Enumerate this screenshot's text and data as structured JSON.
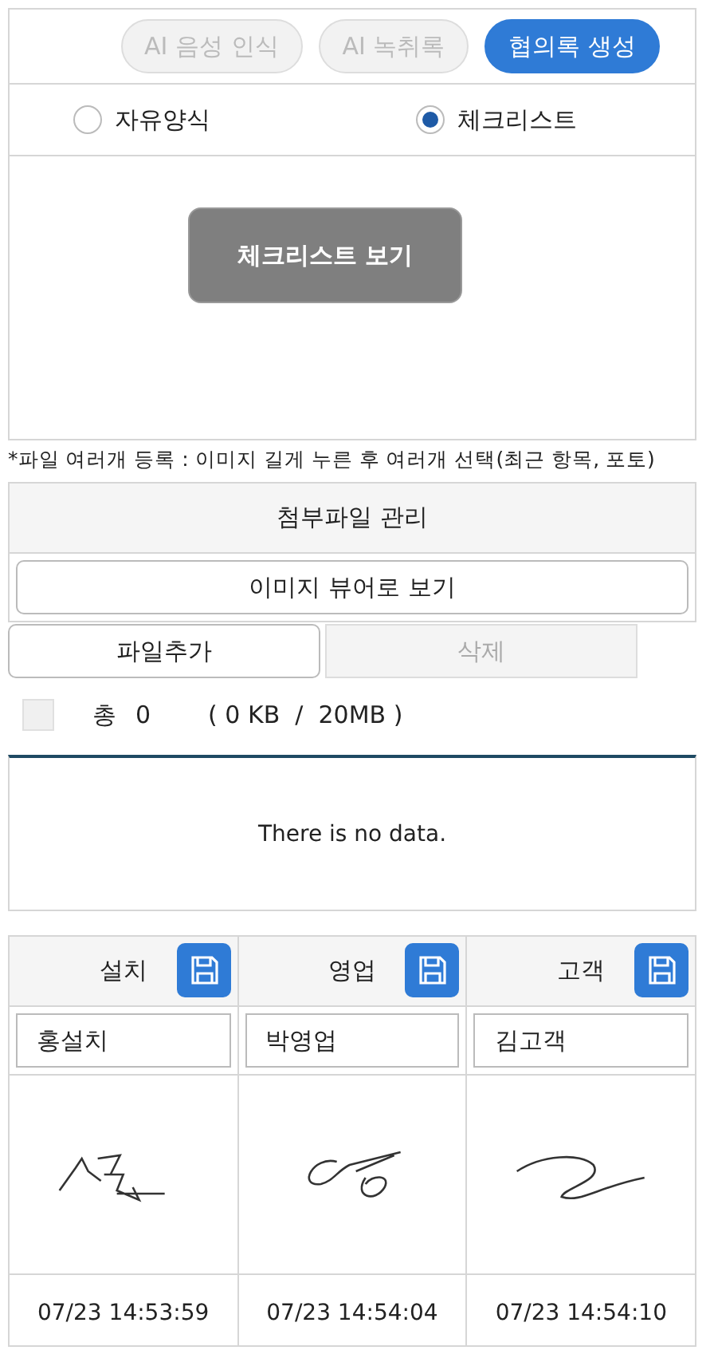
{
  "top_buttons": [
    {
      "label": "AI 음성 인식",
      "disabled": true
    },
    {
      "label": "AI 녹취록",
      "disabled": true
    },
    {
      "label": "협의록 생성",
      "disabled": false
    }
  ],
  "form_types": [
    {
      "label": "자유양식",
      "selected": false
    },
    {
      "label": "체크리스트",
      "selected": true
    }
  ],
  "checklist_button": "체크리스트 보기",
  "note": "*파일 여러개 등록 : 이미지 길게 누른 후 여러개 선택(최근 항목, 포토)",
  "attachments": {
    "title": "첨부파일 관리",
    "viewer_button": "이미지 뷰어로 보기",
    "actions": [
      {
        "label": "파일추가",
        "disabled": false
      },
      {
        "label": "삭제",
        "disabled": true
      }
    ],
    "select_all": {
      "checked": false
    },
    "total_label": "총",
    "total_count": "0",
    "size": "( 0 KB  /  20MB )",
    "empty_message": "There is no data."
  },
  "signatures": [
    {
      "role": "설치",
      "name": "홍설치",
      "time": "07/23 14:53:59"
    },
    {
      "role": "영업",
      "name": "박영업",
      "time": "07/23 14:54:04"
    },
    {
      "role": "고객",
      "name": "김고객",
      "time": "07/23 14:54:10"
    }
  ]
}
